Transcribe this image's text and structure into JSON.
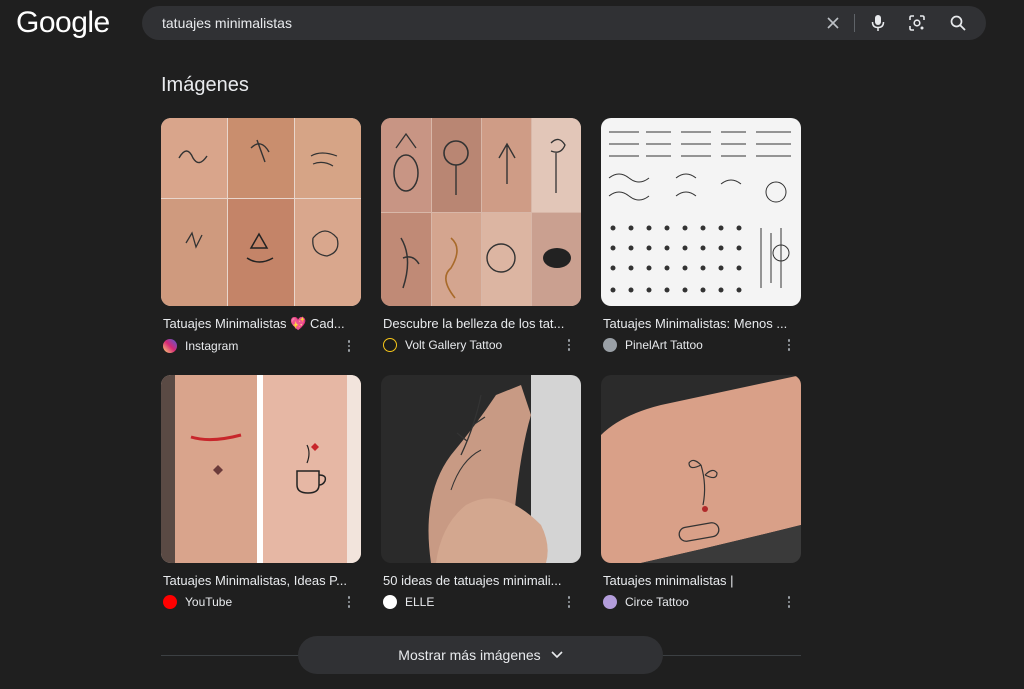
{
  "header": {
    "logo": "Google",
    "search_query": "tatuajes minimalistas",
    "icons": [
      "clear-icon",
      "mic-icon",
      "lens-icon",
      "search-icon"
    ]
  },
  "section": {
    "title": "Imágenes"
  },
  "results": [
    {
      "caption": "Tatuajes Minimalistas 💖 Cad...",
      "source": "Instagram",
      "favicon": "instagram-favicon",
      "favicon_color": "#d62976"
    },
    {
      "caption": "Descubre la belleza de los tat...",
      "source": "Volt Gallery Tattoo",
      "favicon": "volt-favicon",
      "favicon_color": "#f5c518"
    },
    {
      "caption": "Tatuajes Minimalistas: Menos ...",
      "source": "PinelArt Tattoo",
      "favicon": "pinelart-favicon",
      "favicon_color": "#9aa0a6"
    },
    {
      "caption": "Tatuajes Minimalistas, Ideas P...",
      "source": "YouTube",
      "favicon": "youtube-favicon",
      "favicon_color": "#ff0000"
    },
    {
      "caption": "50 ideas de tatuajes minimali...",
      "source": "ELLE",
      "favicon": "elle-favicon",
      "favicon_color": "#ffffff"
    },
    {
      "caption": "Tatuajes minimalistas |",
      "source": "Circe Tattoo",
      "favicon": "circe-favicon",
      "favicon_color": "#b39ddb"
    }
  ],
  "footer": {
    "more_label": "Mostrar más imágenes"
  },
  "colors": {
    "background": "#1f1f1f",
    "searchbox": "#303134",
    "text": "#e8eaed",
    "muted": "#9aa0a6"
  }
}
